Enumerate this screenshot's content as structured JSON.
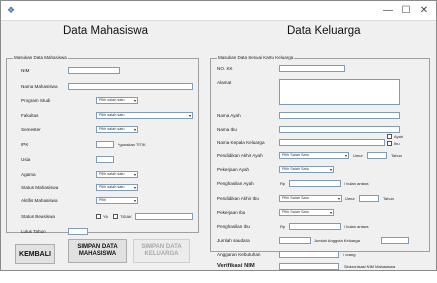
{
  "window": {
    "icon": "app-icon",
    "min_symbol": "—",
    "max_symbol": "☐",
    "close_symbol": "✕"
  },
  "left": {
    "title": "Data Mahasiswa",
    "group_legend": "Masukan Data Mahasiswa",
    "nim_label": "NIM",
    "nama_label": "Nama Mahasiswa",
    "prodi_label": "Program Studi",
    "prodi_value": "Pilih salah satu",
    "fakultas_label": "Fakultas",
    "fakultas_value": "Pilih salah satu",
    "semester_label": "Semester",
    "semester_value": "Pilih salah satu",
    "ipk_label": "IPK",
    "ipk_hint": "*gunakan TITIK",
    "usia_label": "Usia",
    "agama_label": "Agama",
    "agama_value": "Pilih salah satu",
    "status_mhs_label": "Status Mahasiswa",
    "status_mhs_value": "Pilih salah satu",
    "aktifis_label": "Aktifis Mahasiswa",
    "aktifis_value": "Pilih",
    "beasiswa_label": "Status Beasiswa",
    "beasiswa_ya": "YA",
    "beasiswa_tidak": "TIDAK",
    "lulus_label": "Lulus Tahun"
  },
  "right": {
    "title": "Data Keluarga",
    "group_legend": "Masukan Data Sesuai Kartu Keluarga",
    "kk_label": "NO. KK",
    "alamat_label": "Alamat",
    "nama_ayah_label": "Nama Ayah",
    "nama_ibu_label": "Nama Ibu",
    "kepala_label": "Nama Kepala Keluarga",
    "kepala_ayah": "Ayah",
    "kepala_ibu": "Ibu",
    "pend_ayah_label": "Pendidikan Akhir Ayah",
    "pend_ayah_value": "Pilih Salah Satu",
    "umur_label": "Umur",
    "tahun_label": "Tahun",
    "pekerjaan_ayah_label": "Pekerjaan Ayah",
    "pekerjaan_ayah_value": "Pilih Salah Satu",
    "penghasilan_ayah_label": "Penghasilan Ayah",
    "rp_label": "Rp",
    "per_bulan": "/ bulan antara",
    "pend_ibu_label": "Pendidikan Akhir Ibu",
    "pend_ibu_value": "Pilih Salah Satu",
    "umur_ibu_label": "Umur",
    "tahun_ibu_label": "Tahun",
    "pekerjaan_ibu_label": "Pekerjaan Ibu",
    "pekerjaan_ibu_value": "Pilih Salah Satu",
    "penghasilan_ibu_label": "Penghasilan Ibu",
    "jumlah_saudara_label": "Jumlah saudara",
    "jumlah_anggota_label": "Jumlah Anggota Keluarga",
    "anggaran_label": "Anggaran Kebutuhan",
    "per_orang": "/ orang",
    "verifikasi_label": "Verifikasi NIM",
    "verifikasi_hint": "Sinkronisasi NIM Mahasiswa"
  },
  "buttons": {
    "kembali": "KEMBALI",
    "simpan_mhs": "SIMPAN DATA MAHASISWA",
    "simpan_kel": "SIMPAN DATA KELUARGA"
  }
}
